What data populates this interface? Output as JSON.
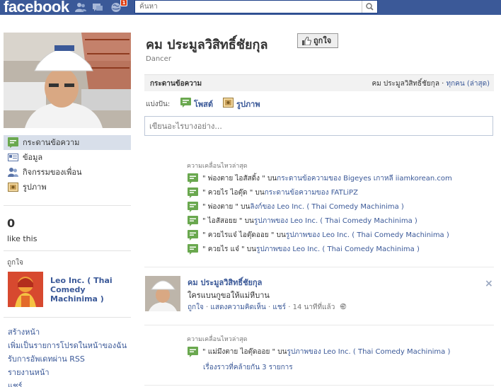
{
  "topbar": {
    "logo": "facebook",
    "notification_count": "1",
    "search": {
      "placeholder": "ค้นหา"
    }
  },
  "profile": {
    "name": "คม ประมูลวิสิทธิ์ชัยกุล",
    "subtitle": "Dancer",
    "like_button": "ถูกใจ"
  },
  "sidebar": {
    "items": [
      {
        "label": "กระดานข้อความ",
        "icon": "wall-icon",
        "active": true
      },
      {
        "label": "ข้อมูล",
        "icon": "info-icon"
      },
      {
        "label": "กิจกรรมของเพื่อน",
        "icon": "friends-icon"
      },
      {
        "label": "รูปภาพ",
        "icon": "photos-icon"
      }
    ],
    "likes_count": "0",
    "likes_label": "like this",
    "liked_title": "ถูกใจ",
    "liked_page_name": "Leo Inc. ( Thai Comedy Machinima )",
    "bottom_links": [
      "สร้างหน้า",
      "เพิ่มเป็นรายการโปรดในหน้าของฉัน",
      "รับการอัพเดทผ่าน RSS",
      "รายงานหน้า",
      "แชร์"
    ]
  },
  "wall": {
    "title": "กระดานข้อความ",
    "filter_name": "คม ประมูลวิสิทธิ์ชัยกุล",
    "filter_sep": " · ",
    "filter_link": "ทุกคน (ล่าสุด)",
    "share_label": "แบ่งปัน:",
    "share_post": "โพสต์",
    "share_photo": "รูปภาพ",
    "composer_placeholder": "เขียนอะไรบางอย่าง..."
  },
  "activity1": {
    "heading": "ความเคลื่อนไหวล่าสุด",
    "lines": [
      {
        "quote": "\" พ่องตาย ไอสัสดิ้ง \" บน",
        "mid": "กระดานข้อความของ ",
        "link": "Bigeyes เกาหลี iiamkorean.com"
      },
      {
        "quote": "\" ควยไร ไอตุ๊ด \" บน",
        "mid": "กระดานข้อความของ ",
        "link": "FATLiPZ"
      },
      {
        "quote": "\" พ่องตาย \" บน",
        "mid": "ลิงก์ของ ",
        "link": "Leo Inc. ( Thai Comedy Machinima )"
      },
      {
        "quote": "\" ไอสัสอยย \" บน",
        "mid": "รูปภาพของ ",
        "link": "Leo Inc. ( Thai Comedy Machinima )"
      },
      {
        "quote": "\" ควยไรแจ๋ ไอตุ๊ดออย \" บน",
        "mid": "รูปภาพของ ",
        "link": "Leo Inc. ( Thai Comedy Machinima )"
      },
      {
        "quote": "\" ควยไร แจ๋ \" บน",
        "mid": "รูปภาพของ ",
        "link": "Leo Inc. ( Thai Comedy Machinima )"
      }
    ]
  },
  "post": {
    "author": "คม ประมูลวิสิทธิ์ชัยกุล",
    "text": "ใครแบนกูขอให้แม่หีบาน",
    "like": "ถูกใจ",
    "comment": "แสดงความคิดเห็น",
    "share": "แชร์",
    "time": "14 นาทีที่แล้ว",
    "dot": " · "
  },
  "activity2": {
    "heading": "ความเคลื่อนไหวล่าสุด",
    "quote": "\" แม่มึงตาย ไอตุ๊ดออย \" บน",
    "mid": "รูปภาพของ ",
    "link": "Leo Inc. ( Thai Comedy Machinima )",
    "more": "เรื่องราวที่คล้ายกัน 3 รายการ"
  },
  "colors": {
    "brand": "#3b5998",
    "accent_green": "#6aa84f",
    "badge": "#dd3c10"
  }
}
